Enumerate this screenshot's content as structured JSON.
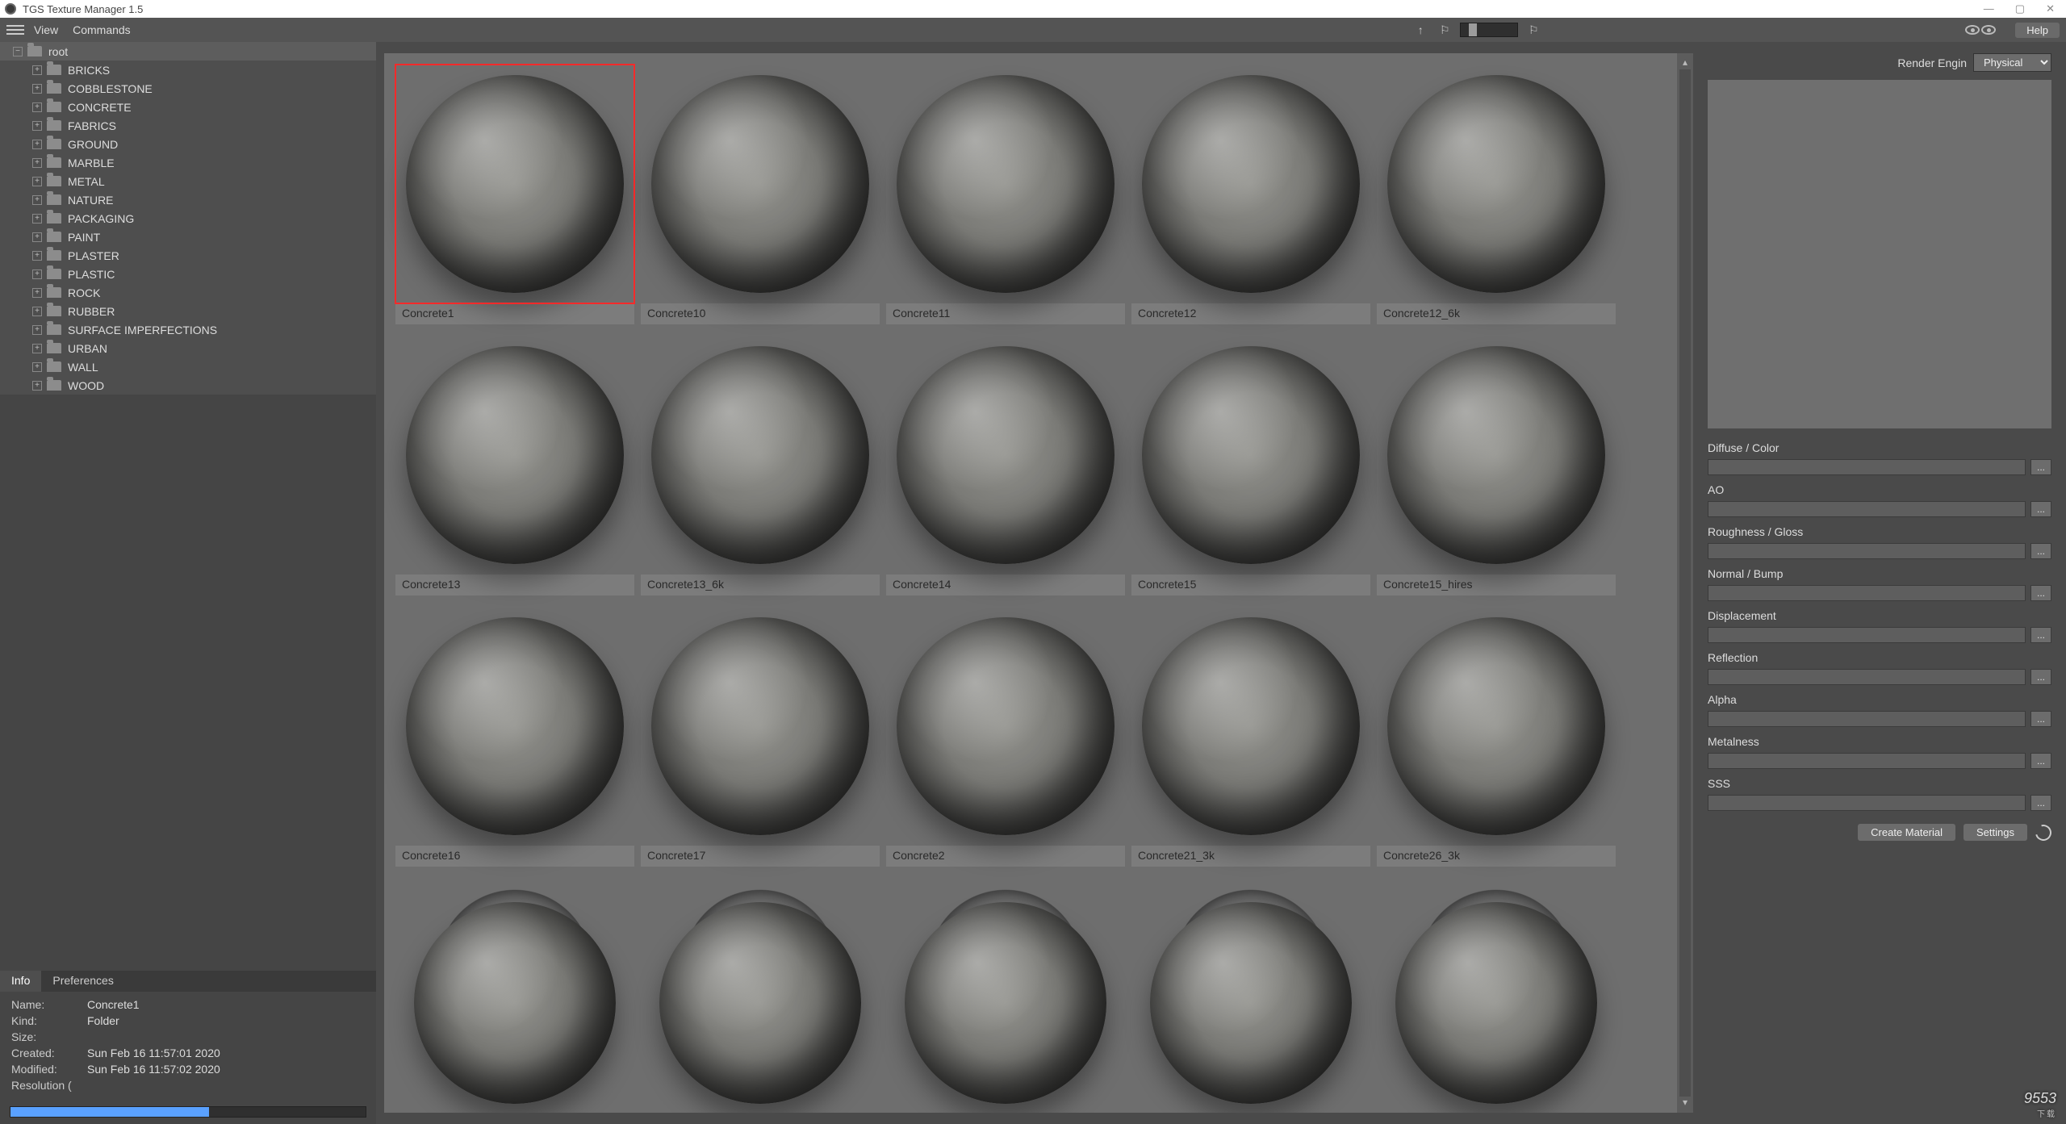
{
  "window": {
    "title": "TGS Texture Manager 1.5"
  },
  "menu": {
    "view": "View",
    "commands": "Commands",
    "help": "Help"
  },
  "tree": {
    "root": "root",
    "children": [
      "BRICKS",
      "COBBLESTONE",
      "CONCRETE",
      "FABRICS",
      "GROUND",
      "MARBLE",
      "METAL",
      "NATURE",
      "PACKAGING",
      "PAINT",
      "PLASTER",
      "PLASTIC",
      "ROCK",
      "RUBBER",
      "SURFACE IMPERFECTIONS",
      "URBAN",
      "WALL",
      "WOOD"
    ]
  },
  "info": {
    "tabs": {
      "info": "Info",
      "prefs": "Preferences"
    },
    "name_lbl": "Name:",
    "name_val": "Concrete1",
    "kind_lbl": "Kind:",
    "kind_val": "Folder",
    "size_lbl": "Size:",
    "size_val": "",
    "created_lbl": "Created:",
    "created_val": "Sun Feb 16 11:57:01 2020",
    "modified_lbl": "Modified:",
    "modified_val": "Sun Feb 16 11:57:02 2020",
    "res_lbl": "Resolution (",
    "res_val": ""
  },
  "grid": {
    "row1": [
      "Concrete1",
      "Concrete10",
      "Concrete11",
      "Concrete12",
      "Concrete12_6k"
    ],
    "row2": [
      "Concrete13",
      "Concrete13_6k",
      "Concrete14",
      "Concrete15",
      "Concrete15_hires"
    ],
    "row3": [
      "Concrete16",
      "Concrete17",
      "Concrete2",
      "Concrete21_3k",
      "Concrete26_3k"
    ]
  },
  "props": {
    "renderengine_lbl": "Render Engin",
    "renderengine_val": "Physical",
    "channels": {
      "diffuse": "Diffuse / Color",
      "ao": "AO",
      "rough": "Roughness / Gloss",
      "normal": "Normal / Bump",
      "disp": "Displacement",
      "refl": "Reflection",
      "alpha": "Alpha",
      "metal": "Metalness",
      "sss": "SSS"
    },
    "ellipsis": "...",
    "create": "Create Material",
    "settings": "Settings"
  },
  "watermark": {
    "brand": "9553",
    "sub": "下载"
  }
}
